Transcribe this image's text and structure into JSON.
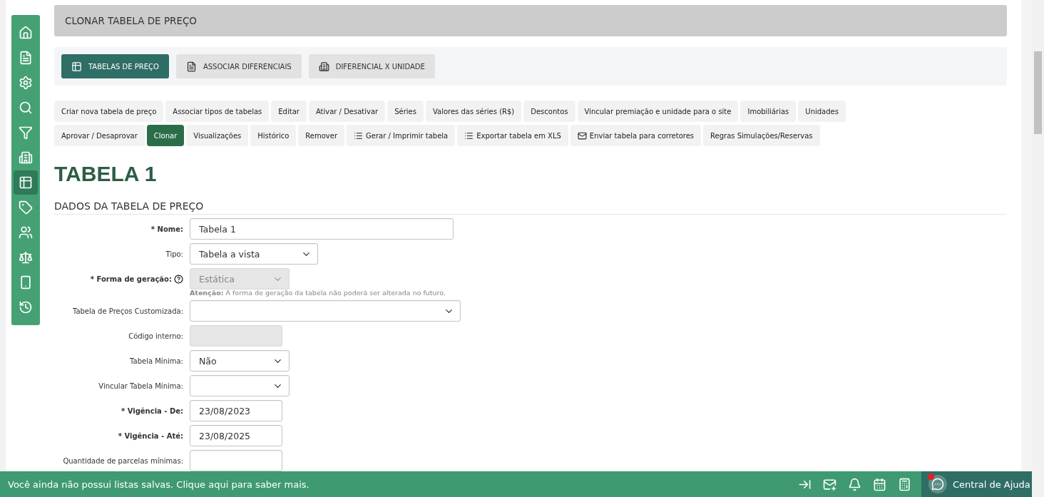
{
  "sidebar": {
    "items": [
      {
        "selected": false
      },
      {
        "selected": false
      },
      {
        "selected": false
      },
      {
        "selected": false
      },
      {
        "selected": false
      },
      {
        "selected": false
      },
      {
        "selected": true
      },
      {
        "selected": false
      },
      {
        "selected": false
      },
      {
        "selected": false
      },
      {
        "selected": false
      },
      {
        "selected": false
      }
    ]
  },
  "header": {
    "title": "CLONAR TABELA DE PREÇO"
  },
  "tabs": [
    {
      "label": "TABELAS DE PREÇO",
      "selected": true
    },
    {
      "label": "ASSOCIAR DIFERENCIAIS",
      "selected": false
    },
    {
      "label": "DIFERENCIAL X UNIDADE",
      "selected": false
    }
  ],
  "actions": [
    {
      "label": "Criar nova tabela de preço",
      "selected": false
    },
    {
      "label": "Associar tipos de tabelas",
      "selected": false
    },
    {
      "label": "Editar",
      "selected": false
    },
    {
      "label": "Ativar / Desativar",
      "selected": false
    },
    {
      "label": "Séries",
      "selected": false
    },
    {
      "label": "Valores das séries (R$)",
      "selected": false
    },
    {
      "label": "Descontos",
      "selected": false
    },
    {
      "label": "Vincular premiação e unidade para o site",
      "selected": false
    },
    {
      "label": "Imobiliárias",
      "selected": false
    },
    {
      "label": "Unidades",
      "selected": false
    },
    {
      "label": "Aprovar / Desaprovar",
      "selected": false
    },
    {
      "label": "Clonar",
      "selected": true
    },
    {
      "label": "Visualizações",
      "selected": false
    },
    {
      "label": "Histórico",
      "selected": false
    },
    {
      "label": "Remover",
      "selected": false
    },
    {
      "label": "Gerar / Imprimir tabela",
      "selected": false
    },
    {
      "label": "Exportar tabela em XLS",
      "selected": false
    },
    {
      "label": "Enviar tabela para corretores",
      "selected": false
    },
    {
      "label": "Regras Simulações/Reservas",
      "selected": false
    }
  ],
  "page_title": "TABELA 1",
  "section_title": "DADOS DA TABELA DE PREÇO",
  "fields": [
    {
      "label": "* Nome:",
      "required": true,
      "kind": "text",
      "value": "Tabela 1",
      "disabled": false
    },
    {
      "label": "Tipo:",
      "required": false,
      "kind": "select",
      "value": "Tabela a vista",
      "disabled": false
    },
    {
      "label": "* Forma de geração:",
      "required": true,
      "kind": "select",
      "value": "Estática",
      "disabled": true,
      "help": true,
      "note": "**Atenção:** A forma de geração da tabela não poderá ser alterada no futuro."
    },
    {
      "label": "Tabela de Preços Customizada:",
      "required": false,
      "kind": "select",
      "disabled": false
    },
    {
      "label": "Código interno:",
      "required": false,
      "kind": "text",
      "disabled": true
    },
    {
      "label": "Tabela Mínima:",
      "required": false,
      "kind": "select",
      "value": "Não",
      "disabled": false
    },
    {
      "label": "Vincular Tabela Mínima:",
      "required": false,
      "kind": "select",
      "disabled": false
    },
    {
      "label": "* Vigência - De:",
      "required": true,
      "kind": "text",
      "value": "23/08/2023",
      "disabled": false
    },
    {
      "label": "* Vigência - Até:",
      "required": true,
      "kind": "text",
      "value": "23/08/2025",
      "disabled": false
    },
    {
      "label": "Quantidade de parcelas mínimas:",
      "required": false,
      "kind": "text",
      "disabled": false
    }
  ],
  "footer": {
    "message": "Você ainda não possui listas salvas. Clique aqui para saber mais.",
    "help": {
      "label": "Central de Ajuda",
      "notification": true
    }
  }
}
